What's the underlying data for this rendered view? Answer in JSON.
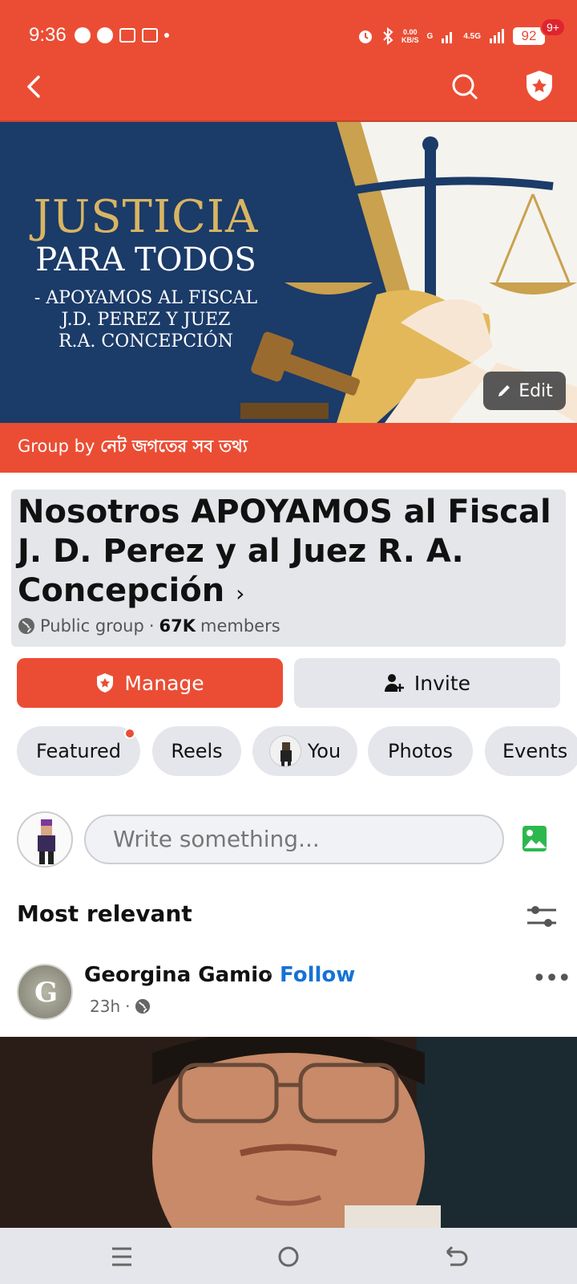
{
  "status_bar": {
    "time": "9:36",
    "net_speed_top": "0.00",
    "net_speed_bottom": "KB/S",
    "net_g": "G",
    "net_45g": "4.5G",
    "battery": "92",
    "icons": [
      "alarm-icon",
      "bluetooth-icon",
      "signal-icon"
    ]
  },
  "app_bar": {
    "notification_badge": "9+",
    "icons": [
      "back-arrow-icon",
      "search-icon",
      "shield-star-icon"
    ]
  },
  "cover": {
    "line1": "JUSTICIA",
    "line2": "PARA TODOS",
    "line3": "- APOYAMOS AL FISCAL",
    "line4": "J.D. PEREZ Y JUEZ",
    "line5": "R.A. CONCEPCIÓN",
    "edit_label": "Edit"
  },
  "group_by": {
    "prefix": "Group by",
    "owner": "নেট জগতের সব তথ্য"
  },
  "group": {
    "title": "Nosotros APOYAMOS al Fiscal J. D. Perez y al Juez R. A. Concepción",
    "chevron": "›",
    "privacy": "Public group",
    "separator": "·",
    "member_count": "67K",
    "members_label": "members"
  },
  "actions": {
    "manage_label": "Manage",
    "invite_label": "Invite"
  },
  "tabs": [
    {
      "label": "Featured"
    },
    {
      "label": "Reels"
    },
    {
      "label": "You"
    },
    {
      "label": "Photos"
    },
    {
      "label": "Events"
    }
  ],
  "composer": {
    "placeholder": "Write something..."
  },
  "feed": {
    "sort_label": "Most relevant"
  },
  "post": {
    "author": "Georgina Gamio",
    "separator": "·",
    "follow_label": "Follow",
    "time": "23h",
    "time_separator": "·",
    "avatar_letter": "G",
    "more_label": "•••"
  },
  "colors": {
    "brand": "#eb4d34",
    "link": "#1672d6",
    "chip_bg": "#e4e6eb"
  }
}
